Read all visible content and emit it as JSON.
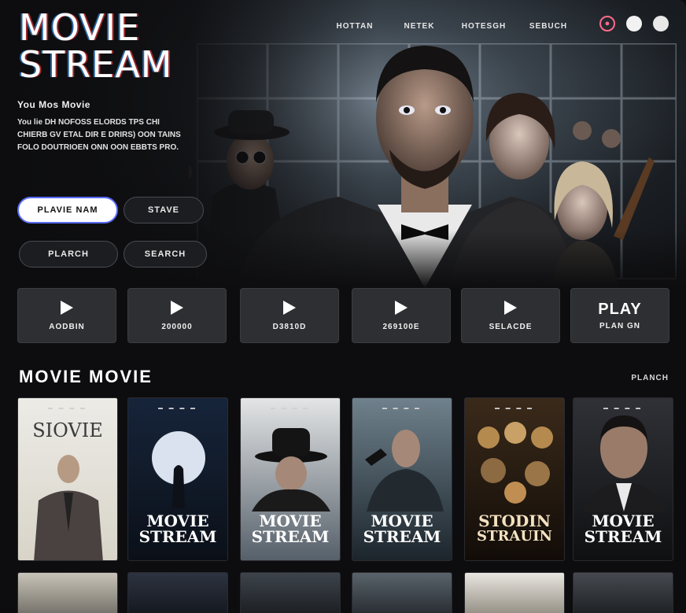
{
  "app": {
    "logo_line1": "MOVIE",
    "logo_line2": "STREAM"
  },
  "nav": [
    "HOTTAN",
    "NETEK",
    "HOTESGH",
    "SEBUCH"
  ],
  "hero": {
    "title": "You Mos Movie",
    "description": "You lie DH NOFOSS ELORDS TPS CHI CHIERB GV ETAL DIR E DRIRS) OON TAINS FOLO DOUTRIOEN ONN OON EBBTS PRO.",
    "buttons": {
      "play_now": "PLAVIE NAM",
      "stave": "STAVE",
      "planch": "PLARCH",
      "search": "SEARCH"
    }
  },
  "tiles": [
    {
      "label": "AODBIN",
      "icon": "play-icon"
    },
    {
      "label": "200000",
      "icon": "play-icon"
    },
    {
      "label": "D3810D",
      "icon": "play-icon"
    },
    {
      "label": "269100E",
      "icon": "play-icon"
    },
    {
      "label": "SELACDE",
      "icon": "play-icon"
    },
    {
      "label": "PLAN GN",
      "big": "PLAY"
    }
  ],
  "section": {
    "title": "MOVIE  MOVIE",
    "link": "PLANCH"
  },
  "posters": [
    {
      "title_top": "SIOVIE",
      "title_bottom": ""
    },
    {
      "title_top": "MOVIE",
      "title_bottom": "STREAM"
    },
    {
      "title_top": "MOVIE",
      "title_bottom": "STREAM"
    },
    {
      "title_top": "MOVIE",
      "title_bottom": "STREAM"
    },
    {
      "title_top": "STODIN",
      "title_bottom": "STRAUIN"
    },
    {
      "title_top": "MOVIE",
      "title_bottom": "STREAM"
    }
  ],
  "colors": {
    "background": "#0d0d0f",
    "tile": "#2e2f33",
    "accent_border": "#5a6cff",
    "icon_pink": "#ff6b8a"
  }
}
